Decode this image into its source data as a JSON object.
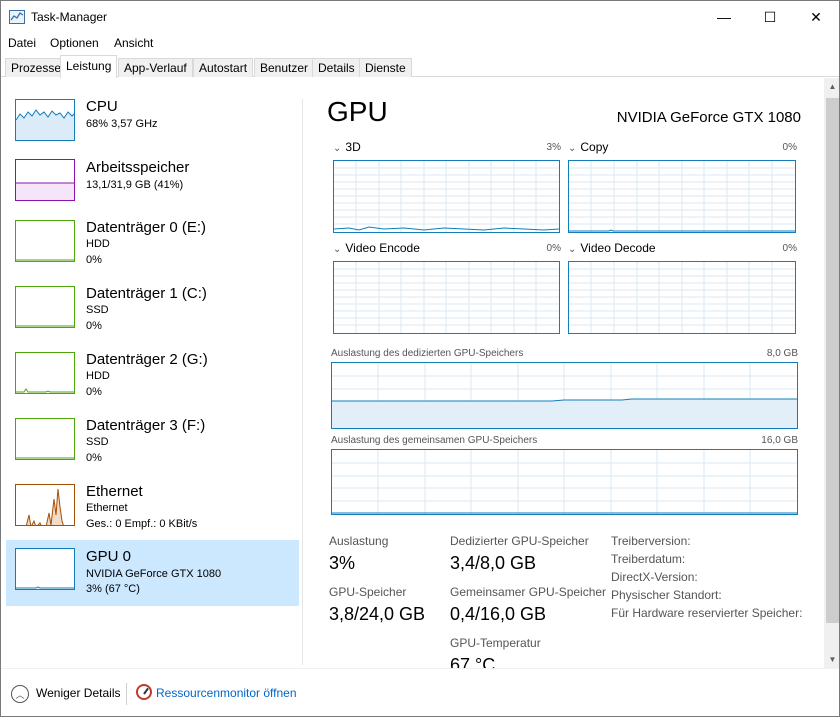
{
  "window": {
    "title": "Task-Manager",
    "minimize": "—",
    "maximize": "☐",
    "close": "✕"
  },
  "menu": [
    "Datei",
    "Optionen",
    "Ansicht"
  ],
  "tabs": [
    "Prozesse",
    "Leistung",
    "App-Verlauf",
    "Autostart",
    "Benutzer",
    "Details",
    "Dienste"
  ],
  "active_tab": "Leistung",
  "sidebar": {
    "items": [
      {
        "title": "CPU",
        "line1": "68% 3,57 GHz",
        "line2": ""
      },
      {
        "title": "Arbeitsspeicher",
        "line1": "13,1/31,9 GB (41%)",
        "line2": ""
      },
      {
        "title": "Datenträger 0 (E:)",
        "line1": "HDD",
        "line2": "0%"
      },
      {
        "title": "Datenträger 1 (C:)",
        "line1": "SSD",
        "line2": "0%"
      },
      {
        "title": "Datenträger 2 (G:)",
        "line1": "HDD",
        "line2": "0%"
      },
      {
        "title": "Datenträger 3 (F:)",
        "line1": "SSD",
        "line2": "0%"
      },
      {
        "title": "Ethernet",
        "line1": "Ethernet",
        "line2": "Ges.: 0 Empf.: 0 KBit/s"
      },
      {
        "title": "GPU 0",
        "line1": "NVIDIA GeForce GTX 1080",
        "line2": "3% (67 °C)"
      }
    ],
    "selected_index": 7
  },
  "main": {
    "heading": "GPU",
    "model": "NVIDIA GeForce GTX 1080",
    "engines": [
      {
        "name": "3D",
        "pct": "3%"
      },
      {
        "name": "Copy",
        "pct": "0%"
      },
      {
        "name": "Video Encode",
        "pct": "0%"
      },
      {
        "name": "Video Decode",
        "pct": "0%"
      }
    ],
    "dedicated_label": "Auslastung des dedizierten GPU-Speichers",
    "dedicated_max": "8,0 GB",
    "shared_label": "Auslastung des gemeinsamen GPU-Speichers",
    "shared_max": "16,0 GB",
    "stats": {
      "auslastung_label": "Auslastung",
      "auslastung_value": "3%",
      "gpu_speicher_label": "GPU-Speicher",
      "gpu_speicher_value": "3,8/24,0 GB",
      "dediziert_label": "Dedizierter GPU-Speicher",
      "dediziert_value": "3,4/8,0 GB",
      "gemeinsam_label": "Gemeinsamer GPU-Speicher",
      "gemeinsam_value": "0,4/16,0 GB",
      "temp_label": "GPU-Temperatur",
      "temp_value": "67 °C"
    },
    "properties": [
      "Treiberversion:",
      "Treiberdatum:",
      "DirectX-Version:",
      "Physischer Standort:",
      "Für Hardware reservierter Speicher:"
    ]
  },
  "footer": {
    "fewer_details": "Weniger Details",
    "resource_monitor": "Ressourcenmonitor öffnen"
  },
  "colors": {
    "cpu": "#117dbb",
    "memory": "#8b12ae",
    "disk": "#4da60c",
    "ethernet": "#a74f01",
    "gpu": "#117dbb",
    "selected_bg": "#cce8ff",
    "grid": "#d9eaf4"
  }
}
